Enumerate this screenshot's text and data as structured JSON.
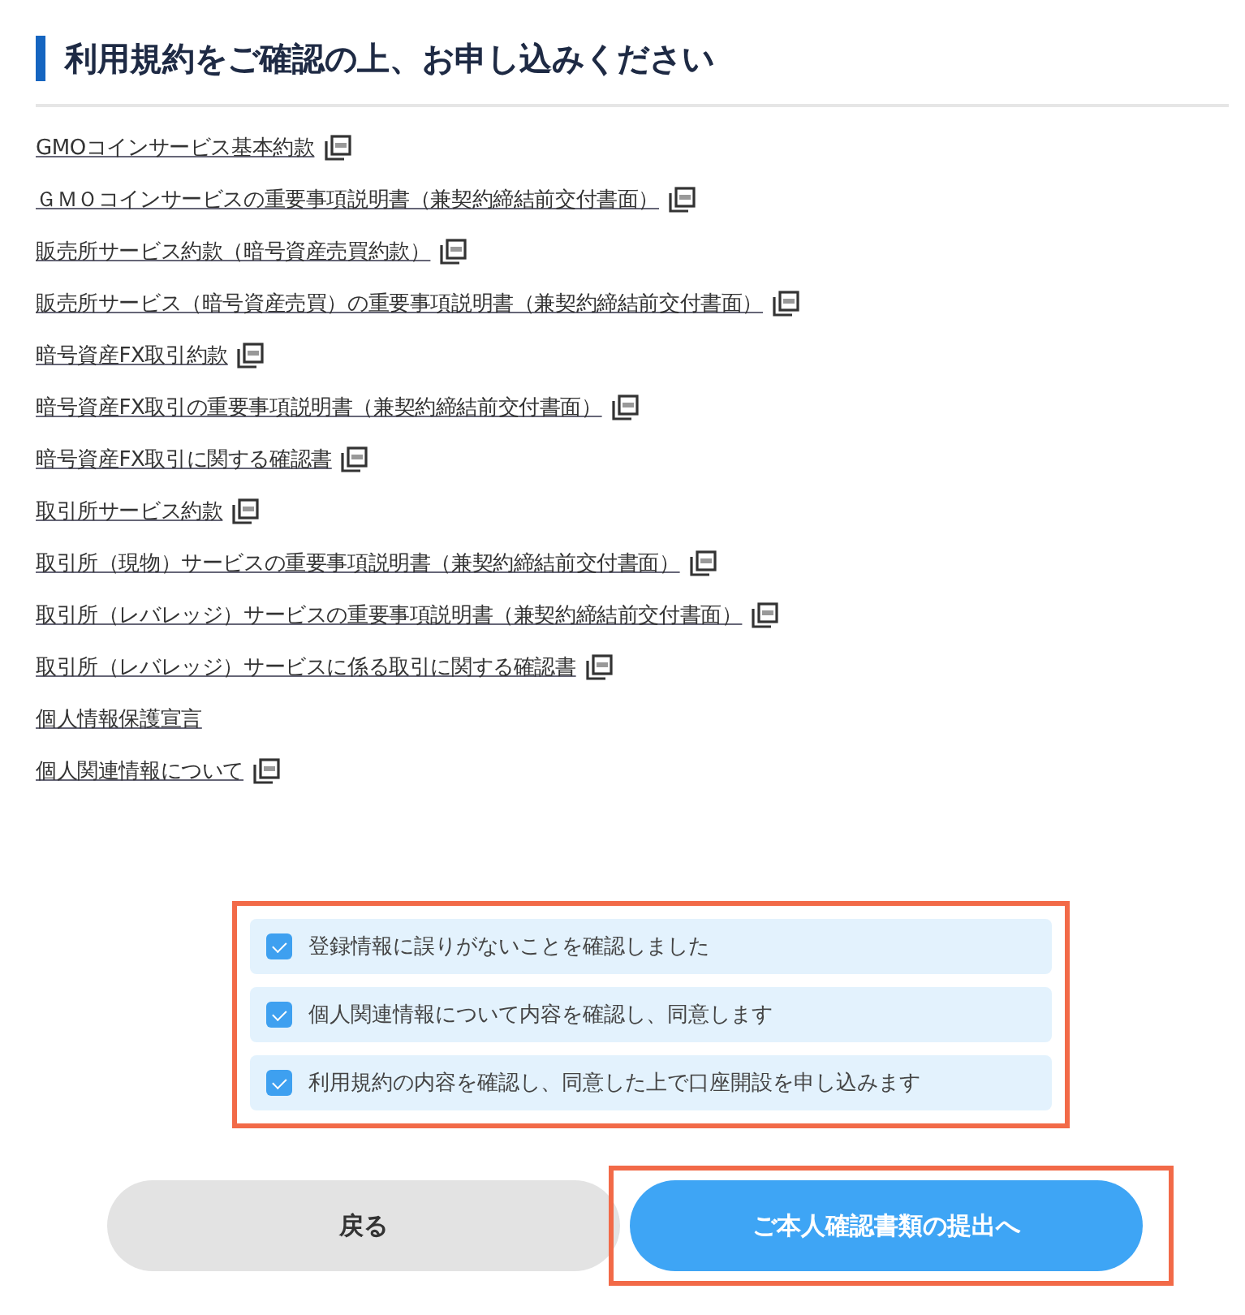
{
  "heading": "利用規約をご確認の上、お申し込みください",
  "documents": [
    {
      "label": "GMOコインサービス基本約款",
      "pdf": true
    },
    {
      "label": "ＧＭＯコインサービスの重要事項説明書（兼契約締結前交付書面）",
      "pdf": true
    },
    {
      "label": "販売所サービス約款（暗号資産売買約款）",
      "pdf": true
    },
    {
      "label": "販売所サービス（暗号資産売買）の重要事項説明書（兼契約締結前交付書面）",
      "pdf": true
    },
    {
      "label": "暗号資産FX取引約款",
      "pdf": true
    },
    {
      "label": "暗号資産FX取引の重要事項説明書（兼契約締結前交付書面）",
      "pdf": true
    },
    {
      "label": "暗号資産FX取引に関する確認書",
      "pdf": true
    },
    {
      "label": "取引所サービス約款",
      "pdf": true
    },
    {
      "label": "取引所（現物）サービスの重要事項説明書（兼契約締結前交付書面）",
      "pdf": true
    },
    {
      "label": "取引所（レバレッジ）サービスの重要事項説明書（兼契約締結前交付書面）",
      "pdf": true
    },
    {
      "label": "取引所（レバレッジ）サービスに係る取引に関する確認書",
      "pdf": true
    },
    {
      "label": "個人情報保護宣言",
      "pdf": false
    },
    {
      "label": "個人関連情報について",
      "pdf": true
    }
  ],
  "agreements": {
    "highlighted": true,
    "items": [
      {
        "label": "登録情報に誤りがないことを確認しました",
        "checked": true
      },
      {
        "label": "個人関連情報について内容を確認し、同意します",
        "checked": true
      },
      {
        "label": "利用規約の内容を確認し、同意した上で口座開設を申し込みます",
        "checked": true
      }
    ]
  },
  "buttons": [
    {
      "label": "戻る",
      "kind": "secondary",
      "highlighted": false
    },
    {
      "label": "ご本人確認書類の提出へ",
      "kind": "primary",
      "highlighted": true
    }
  ]
}
